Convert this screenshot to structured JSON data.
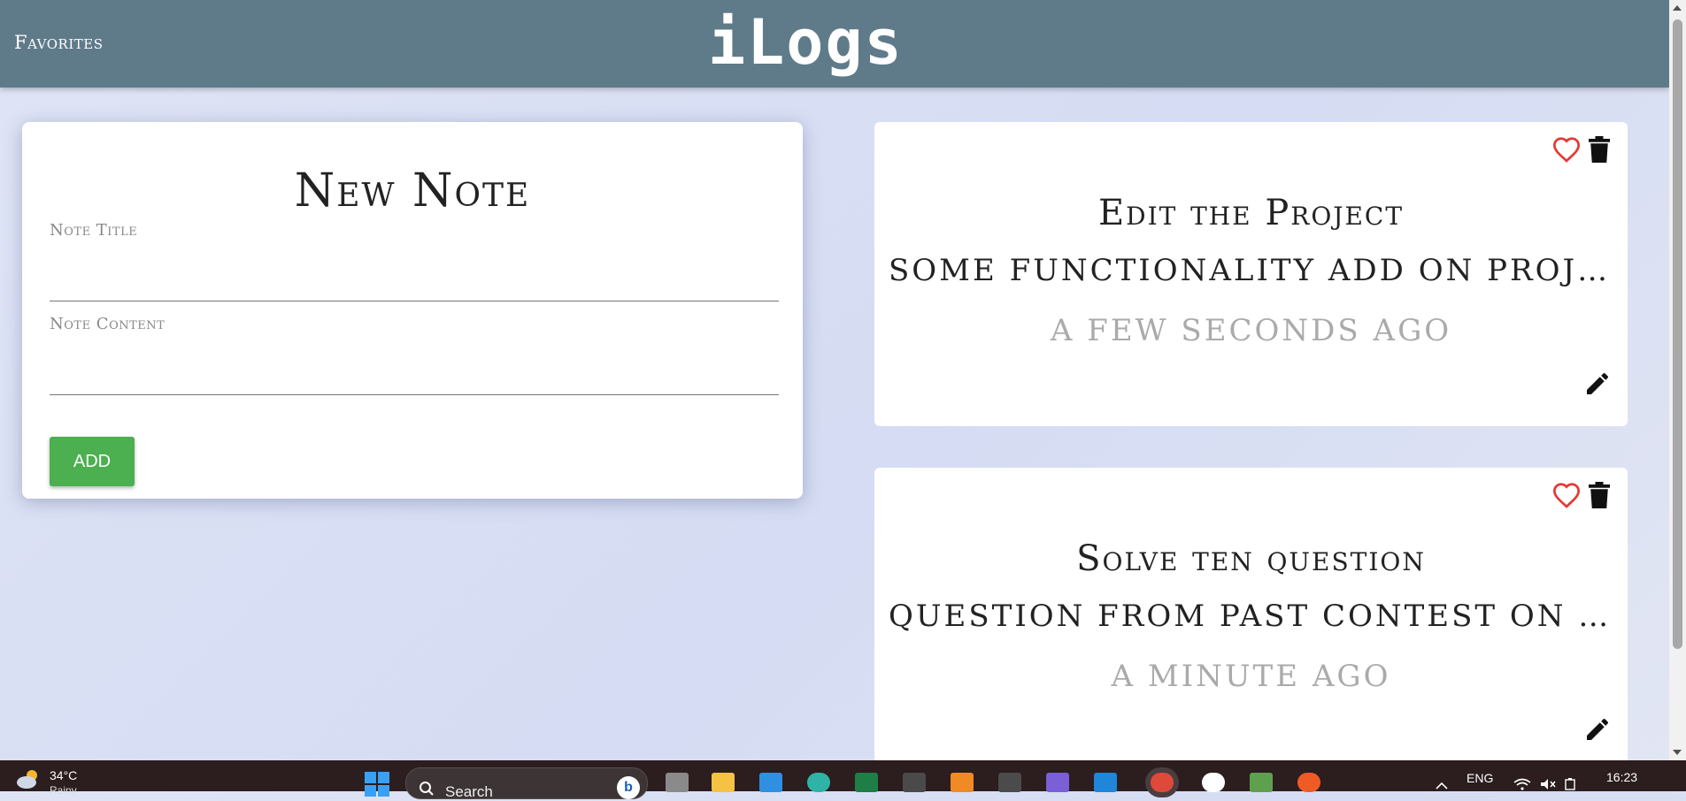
{
  "header": {
    "favorites_label": "Favorites",
    "logo": "iLogs",
    "background": "#5f7b8a"
  },
  "form": {
    "title": "New Note",
    "title_label": "Note Title",
    "title_value": "",
    "content_label": "Note Content",
    "content_value": "",
    "add_label": "ADD",
    "add_color": "#4caf50"
  },
  "notes": [
    {
      "title": "Edit the Project",
      "content": "some functionality add on project th...",
      "time": "a few seconds ago"
    },
    {
      "title": "Solve ten question",
      "content": "Question from past contest on leetco...",
      "time": "a minute ago"
    }
  ],
  "icons": {
    "favorite": "heart-outline-icon",
    "delete": "trash-icon",
    "edit": "pencil-icon",
    "favorite_color": "#e53935"
  },
  "taskbar": {
    "temperature": "34°C",
    "weather_sub": "Rainy",
    "search_label": "Search",
    "language": "ENG",
    "time": "16:23",
    "apps": [
      "task-view",
      "file-explorer",
      "mail",
      "edge",
      "excel",
      "clapper",
      "xampp",
      "sublime-text",
      "visual-studio",
      "vscode",
      "chrome",
      "mongodb",
      "nodejs",
      "postman"
    ]
  }
}
